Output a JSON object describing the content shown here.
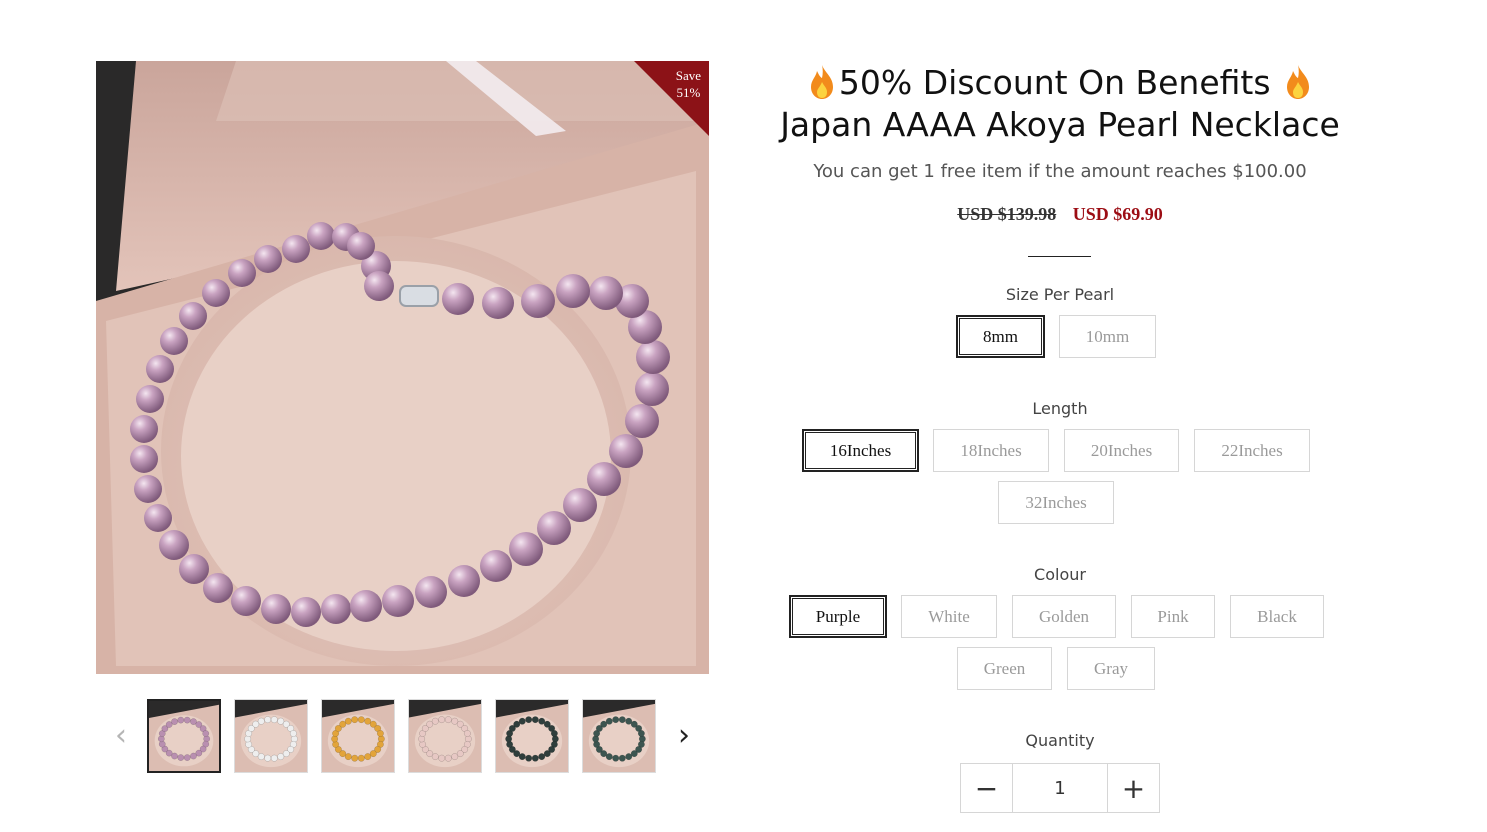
{
  "product": {
    "badge": {
      "line1": "Save",
      "line2": "51%"
    },
    "title": {
      "part1": "50% Discount On Benefits",
      "part2": "Japan AAAA Akoya Pearl Necklace",
      "icon": "fire-emoji-icon"
    },
    "promo_text": "You can get 1 free item if the amount reaches $100.00",
    "price_compare": "USD $139.98",
    "price_sale": "USD $69.90"
  },
  "gallery": {
    "prev_icon": "‹",
    "next_icon": "›",
    "thumbnails": [
      {
        "pearl_color": "#b98fb0",
        "label": "purple pearls"
      },
      {
        "pearl_color": "#eeeeee",
        "label": "white pearls"
      },
      {
        "pearl_color": "#e2a43b",
        "label": "golden pearls"
      },
      {
        "pearl_color": "#e7c8c4",
        "label": "pink pearls"
      },
      {
        "pearl_color": "#2f3e3c",
        "label": "black pearls"
      },
      {
        "pearl_color": "#3c5550",
        "label": "green pearls"
      }
    ]
  },
  "options": {
    "size": {
      "label": "Size Per Pearl",
      "values": [
        "8mm",
        "10mm"
      ],
      "selected": "8mm"
    },
    "length": {
      "label": "Length",
      "values": [
        "16Inches",
        "18Inches",
        "20Inches",
        "22Inches",
        "32Inches"
      ],
      "selected": "16Inches"
    },
    "colour": {
      "label": "Colour",
      "values": [
        "Purple",
        "White",
        "Golden",
        "Pink",
        "Black",
        "Green",
        "Gray"
      ],
      "selected": "Purple"
    }
  },
  "quantity": {
    "label": "Quantity",
    "value": "1",
    "minus": "−",
    "plus": "+"
  },
  "colors": {
    "sale_price": "#9c0d14",
    "badge": "#8c1217",
    "pearl_purple": "#b98fb0"
  }
}
